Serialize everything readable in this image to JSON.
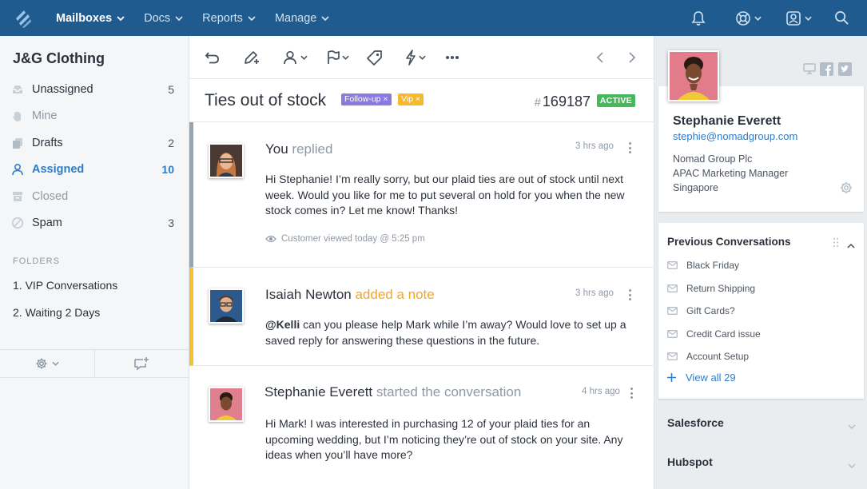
{
  "nav": {
    "items": [
      {
        "label": "Mailboxes",
        "active": true
      },
      {
        "label": "Docs",
        "active": false
      },
      {
        "label": "Reports",
        "active": false
      },
      {
        "label": "Manage",
        "active": false
      }
    ]
  },
  "sidebar": {
    "mailbox_name": "J&G Clothing",
    "folders": [
      {
        "label": "Unassigned",
        "count": "5",
        "icon": "inbox-icon"
      },
      {
        "label": "Mine",
        "count": "",
        "icon": "hand-icon"
      },
      {
        "label": "Drafts",
        "count": "2",
        "icon": "drafts-icon"
      },
      {
        "label": "Assigned",
        "count": "10",
        "icon": "user-icon"
      },
      {
        "label": "Closed",
        "count": "",
        "icon": "archive-icon"
      },
      {
        "label": "Spam",
        "count": "3",
        "icon": "spam-icon"
      }
    ],
    "folders_heading": "FOLDERS",
    "saved_folders": [
      "1. VIP Conversations",
      "2. Waiting 2 Days"
    ]
  },
  "conversation": {
    "subject": "Ties out of stock",
    "tags": [
      "Follow-up ×",
      "Vip ×"
    ],
    "hash": "#",
    "number": "169187",
    "status": "ACTIVE"
  },
  "threads": [
    {
      "author": "You",
      "action": "replied",
      "time": "3 hrs ago",
      "body": [
        "Hi Stephanie!  I’m really sorry, but our plaid ties are out of stock until next",
        "week. Would you like for me to put several on hold for you when the new",
        "stock comes in? Let me know! Thanks!"
      ],
      "viewed": "Customer viewed today @ 5:25 pm"
    },
    {
      "author": "Isaiah Newton",
      "action": "added a note",
      "time": "3 hrs ago",
      "mention": "@Kelli",
      "body": [
        " can you please help Mark while I’m away? Would love to set up a",
        "saved reply for answering these questions in the future."
      ]
    },
    {
      "author": "Stephanie Everett",
      "action": "started the conversation",
      "time": "4 hrs ago",
      "body": [
        "Hi Mark! I was interested in purchasing 12 of your plaid ties for an",
        "upcoming wedding, but I’m noticing they’re out of stock on your site. Any",
        "ideas when you’ll have more?"
      ]
    }
  ],
  "customer": {
    "name": "Stephanie Everett",
    "email": "stephie@nomadgroup.com",
    "company": "Nomad Group Plc",
    "title": "APAC Marketing Manager",
    "location": "Singapore"
  },
  "previous": {
    "title": "Previous Conversations",
    "items": [
      "Black Friday",
      "Return Shipping",
      "Gift Cards?",
      "Credit Card issue",
      "Account Setup"
    ],
    "view_all": "View all 29"
  },
  "apps": [
    "Salesforce",
    "Hubspot"
  ],
  "colors": {
    "topbar": "#1f5b8f",
    "accent": "#2e7cc6",
    "note": "#f5c033",
    "active_badge": "#47b95c"
  }
}
